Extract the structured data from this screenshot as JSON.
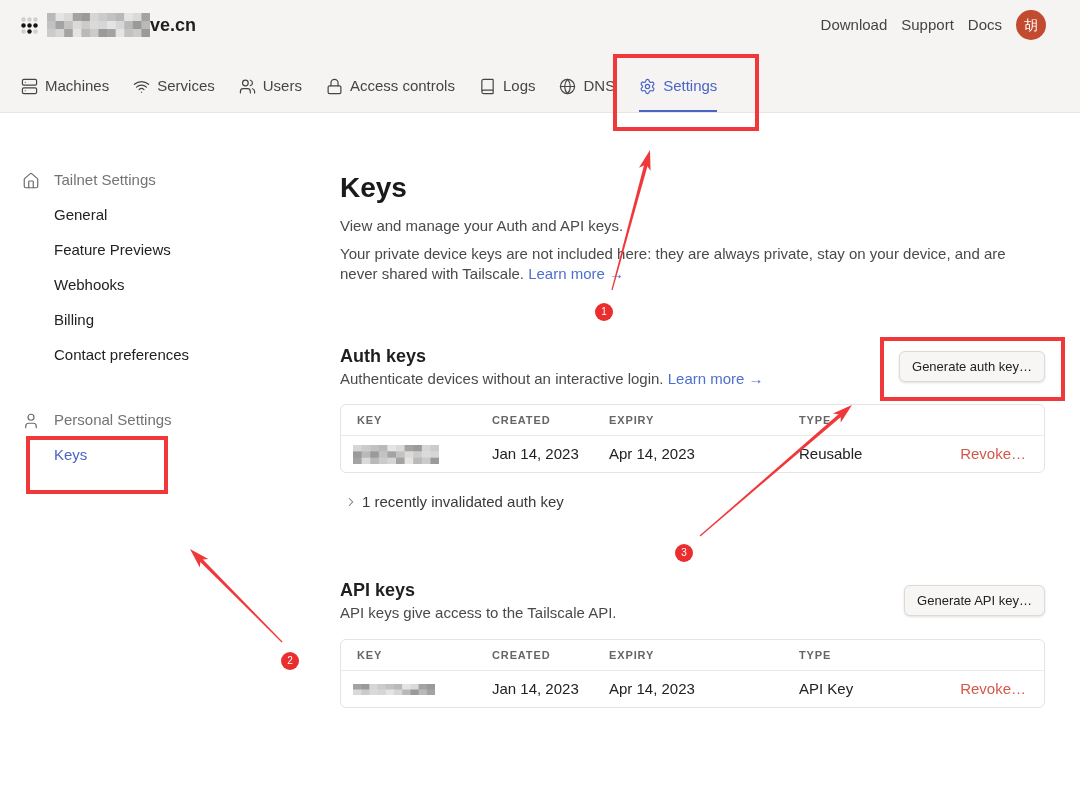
{
  "header": {
    "domain": "ve.cn",
    "links": [
      "Download",
      "Support",
      "Docs"
    ],
    "avatar": "胡"
  },
  "nav": [
    {
      "label": "Machines",
      "selected": false
    },
    {
      "label": "Services",
      "selected": false
    },
    {
      "label": "Users",
      "selected": false
    },
    {
      "label": "Access controls",
      "selected": false
    },
    {
      "label": "Logs",
      "selected": false
    },
    {
      "label": "DNS",
      "selected": false
    },
    {
      "label": "Settings",
      "selected": true
    }
  ],
  "sidebar": [
    {
      "title": "Tailnet Settings",
      "items": [
        {
          "label": "General",
          "selected": false
        },
        {
          "label": "Feature Previews",
          "selected": false
        },
        {
          "label": "Webhooks",
          "selected": false
        },
        {
          "label": "Billing",
          "selected": false
        },
        {
          "label": "Contact preferences",
          "selected": false
        }
      ]
    },
    {
      "title": "Personal Settings",
      "items": [
        {
          "label": "Keys",
          "selected": true
        }
      ]
    }
  ],
  "page": {
    "title": "Keys",
    "intro": "View and manage your Auth and API keys.",
    "note": "Your private device keys are not included here: they are always private, stay on your device, and are never shared with Tailscale.",
    "note_link": "Learn more →"
  },
  "sections": [
    {
      "title": "Auth keys",
      "description": "Authenticate devices without an interactive login.",
      "link": "Learn more →",
      "button": "Generate auth key…",
      "columns": [
        "KEY",
        "CREATED",
        "EXPIRY",
        "TYPE"
      ],
      "rows": [
        {
          "created": "Jan 14, 2023",
          "expiry": "Apr 14, 2023",
          "type": "Reusable",
          "action": "Revoke…"
        }
      ],
      "invalidated": {
        "label": "1 recently invalidated auth key",
        "expanded": false
      }
    },
    {
      "title": "API keys",
      "description": "API keys give access to the Tailscale API.",
      "button": "Generate API key…",
      "columns": [
        "KEY",
        "CREATED",
        "EXPIRY",
        "TYPE"
      ],
      "rows": [
        {
          "created": "Jan 14, 2023",
          "expiry": "Apr 14, 2023",
          "type": "API Key",
          "action": "Revoke…"
        }
      ]
    }
  ],
  "annotations": [
    {
      "number": "1"
    },
    {
      "number": "2"
    },
    {
      "number": "3"
    }
  ]
}
